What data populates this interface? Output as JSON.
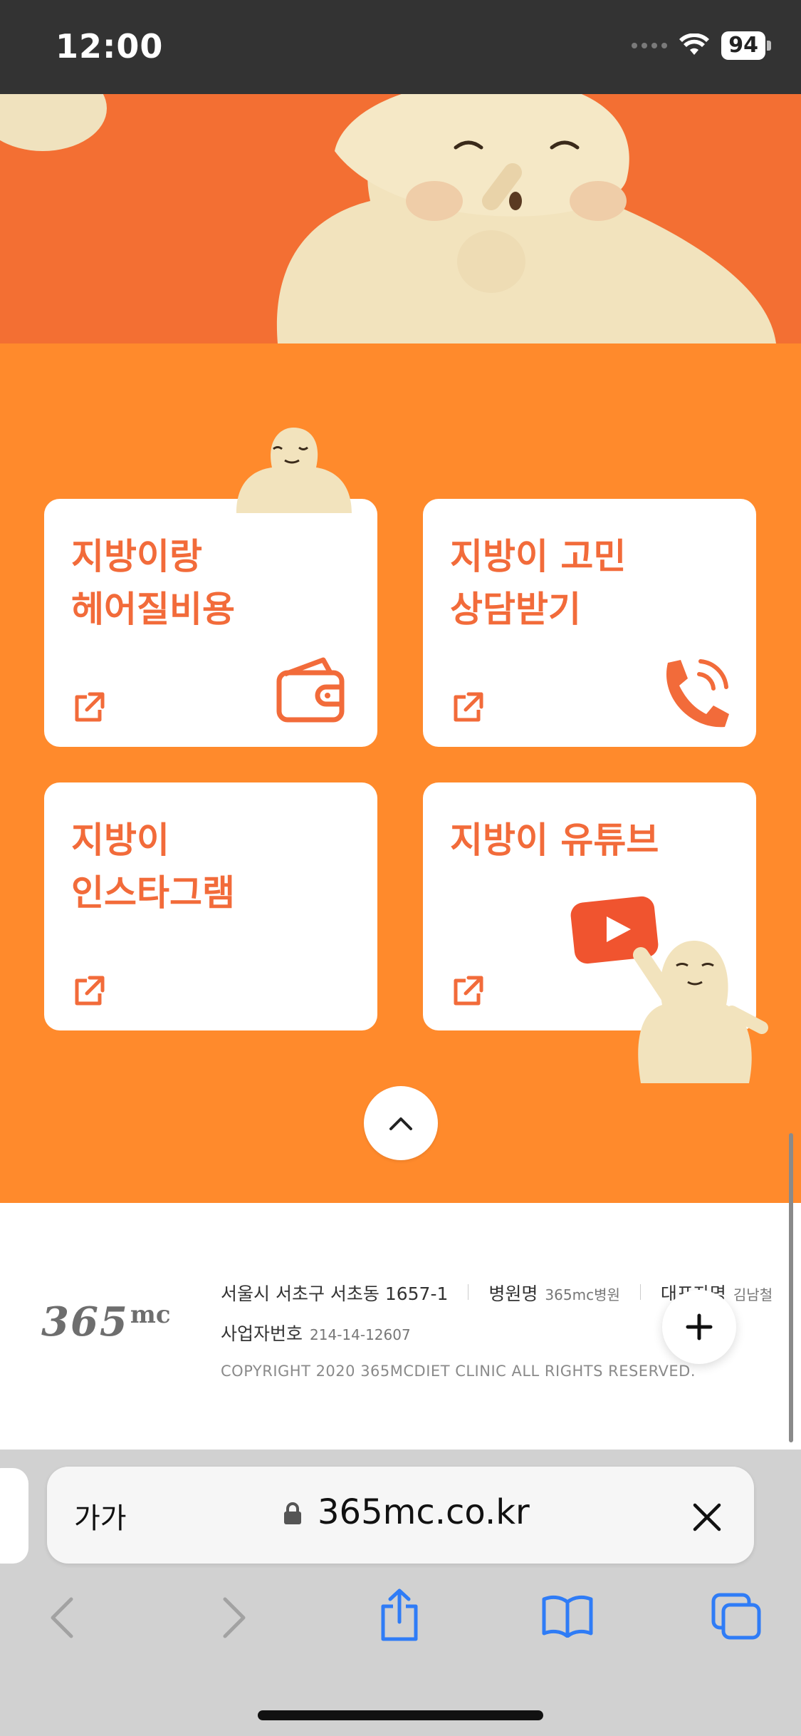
{
  "status_bar": {
    "time": "12:00",
    "battery": "94"
  },
  "cards": [
    {
      "line1": "지방이랑",
      "line2": "헤어질비용",
      "icon": "wallet-icon"
    },
    {
      "line1": "지방이 고민",
      "line2": "상담받기",
      "icon": "phone-icon"
    },
    {
      "line1": "지방이",
      "line2": "인스타그램",
      "icon": ""
    },
    {
      "line1": "지방이 유튜브",
      "line2": "",
      "icon": "youtube-icon"
    }
  ],
  "footer": {
    "logo": "365",
    "logo_sup": "mc",
    "address": "서울시 서초구 서초동 1657-1",
    "hospital_label": "병원명",
    "hospital_value": "365mc병원",
    "ceo_label": "대표자명",
    "ceo_value": "김남철",
    "biz_label": "사업자번호",
    "biz_value": "214-14-12607",
    "copyright": "COPYRIGHT 2020 365MCDIET CLINIC ALL RIGHTS RESERVED."
  },
  "browser": {
    "text_size_label": "가가",
    "url": "365mc.co.kr"
  },
  "colors": {
    "hero": "#F36F33",
    "panel": "#FF8A2C",
    "accent": "#F26B3A",
    "link_blue": "#2F7CF6"
  }
}
